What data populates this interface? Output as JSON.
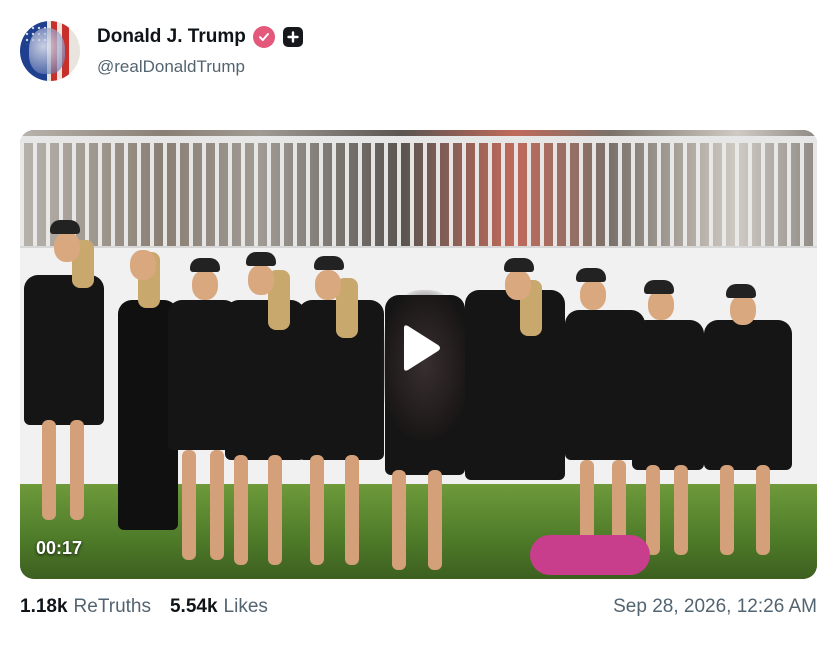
{
  "post": {
    "author": {
      "display_name": "Donald J. Trump",
      "handle": "@realDonaldTrump",
      "verified_icon": "verified-badge-icon",
      "plus_icon": "plus-badge-icon"
    },
    "media": {
      "type": "video",
      "duration": "00:17",
      "play_icon": "play-icon"
    },
    "stats": {
      "retruths_count": "1.18k",
      "retruths_label": "ReTruths",
      "likes_count": "5.54k",
      "likes_label": "Likes"
    },
    "timestamp": "Sep 28, 2026, 12:26 AM"
  },
  "colors": {
    "text_primary": "#0f1419",
    "text_secondary": "#536471",
    "verified_pink": "#e4587c",
    "background": "#ffffff"
  }
}
